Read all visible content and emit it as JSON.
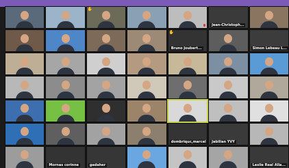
{
  "window": {
    "accent_color": "#7c5ab7",
    "active_speaker_color": "#c9d34a"
  },
  "tiles": [
    {
      "label": "",
      "bg": "#5b6a7a",
      "hand": false,
      "mic": false,
      "big": false
    },
    {
      "label": "",
      "bg": "#9cb4c9",
      "hand": false,
      "mic": false,
      "big": false
    },
    {
      "label": "",
      "bg": "#6c6a58",
      "hand": true,
      "mic": false,
      "big": false
    },
    {
      "label": "",
      "bg": "#8aa0b5",
      "hand": false,
      "mic": false,
      "big": false
    },
    {
      "label": "",
      "bg": "#bdbdbd",
      "hand": false,
      "mic": true,
      "big": false
    },
    {
      "label": "Jean-Christoph...",
      "bg": "#3a3a3a",
      "hand": false,
      "mic": false,
      "big": true
    },
    {
      "label": "",
      "bg": "#8a7660",
      "hand": false,
      "mic": false,
      "big": false
    },
    {
      "label": "",
      "bg": "#6f5a4a",
      "hand": false,
      "mic": false,
      "big": false
    },
    {
      "label": "",
      "bg": "#4e86c7",
      "hand": false,
      "mic": false,
      "big": false
    },
    {
      "label": "",
      "bg": "#7e6a58",
      "hand": false,
      "mic": false,
      "big": false
    },
    {
      "label": "",
      "bg": "#9d8a76",
      "hand": false,
      "mic": false,
      "big": false
    },
    {
      "label": "Bruno Joubert...",
      "bg": "#333333",
      "hand": true,
      "mic": false,
      "big": true
    },
    {
      "label": "",
      "bg": "#5d5d5d",
      "hand": false,
      "mic": false,
      "big": false
    },
    {
      "label": "Simon Lebeau L...",
      "bg": "#3c3c3c",
      "hand": false,
      "mic": false,
      "big": true
    },
    {
      "label": "",
      "bg": "#bfae96",
      "hand": false,
      "mic": false,
      "big": false
    },
    {
      "label": "",
      "bg": "#a6a6a6",
      "hand": false,
      "mic": false,
      "big": false
    },
    {
      "label": "",
      "bg": "#cfcfcf",
      "hand": false,
      "mic": false,
      "big": false
    },
    {
      "label": "",
      "bg": "#b39a80",
      "hand": false,
      "mic": false,
      "big": false
    },
    {
      "label": "",
      "bg": "#c7b89a",
      "hand": false,
      "mic": false,
      "big": false
    },
    {
      "label": "",
      "bg": "#7d8fa3",
      "hand": false,
      "mic": false,
      "big": false
    },
    {
      "label": "",
      "bg": "#5a9bd6",
      "hand": false,
      "mic": false,
      "big": false
    },
    {
      "label": "",
      "bg": "#b8b8b8",
      "hand": false,
      "mic": false,
      "big": false
    },
    {
      "label": "",
      "bg": "#8c8c8c",
      "hand": false,
      "mic": false,
      "big": false
    },
    {
      "label": "",
      "bg": "#a3a3a3",
      "hand": false,
      "mic": false,
      "big": false
    },
    {
      "label": "",
      "bg": "#d0c8b8",
      "hand": false,
      "mic": false,
      "big": false
    },
    {
      "label": "",
      "bg": "#6e6e6e",
      "hand": false,
      "mic": false,
      "big": false
    },
    {
      "label": "",
      "bg": "#c9c9c9",
      "hand": false,
      "mic": false,
      "big": false
    },
    {
      "label": "",
      "bg": "#b0a89a",
      "hand": false,
      "mic": false,
      "big": false
    },
    {
      "label": "",
      "bg": "#3d6fb0",
      "hand": false,
      "mic": false,
      "big": false
    },
    {
      "label": "",
      "bg": "#76c043",
      "hand": false,
      "mic": false,
      "big": false
    },
    {
      "label": "",
      "bg": "#2f2f2f",
      "hand": false,
      "mic": false,
      "big": false
    },
    {
      "label": "",
      "bg": "#9b8468",
      "hand": false,
      "mic": false,
      "big": false
    },
    {
      "label": "",
      "bg": "#d9d9d9",
      "hand": false,
      "mic": false,
      "big": false,
      "active": true
    },
    {
      "label": "",
      "bg": "#bfbfbf",
      "hand": false,
      "mic": false,
      "big": false
    },
    {
      "label": "",
      "bg": "#e0e0e0",
      "hand": false,
      "mic": false,
      "big": false
    },
    {
      "label": "",
      "bg": "#2f6fb5",
      "hand": false,
      "mic": false,
      "big": false
    },
    {
      "label": "",
      "bg": "#5f5f5f",
      "hand": false,
      "mic": false,
      "big": false
    },
    {
      "label": "",
      "bg": "#a2a2a2",
      "hand": false,
      "mic": false,
      "big": false
    },
    {
      "label": "",
      "bg": "#8c7f6e",
      "hand": false,
      "mic": false,
      "big": false
    },
    {
      "label": "dombriquc,marcel",
      "bg": "#343434",
      "hand": false,
      "mic": false,
      "big": true
    },
    {
      "label": "Jabilian YVY",
      "bg": "#3a3a3a",
      "hand": false,
      "mic": false,
      "big": true
    },
    {
      "label": "",
      "bg": "#b7b7b7",
      "hand": false,
      "mic": false,
      "big": false
    },
    {
      "label": "",
      "bg": "#9c9c9c",
      "hand": false,
      "mic": false,
      "big": false
    },
    {
      "label": "Mornas corinne",
      "bg": "#333333",
      "hand": false,
      "mic": false,
      "big": true
    },
    {
      "label": "gadaher",
      "bg": "#363636",
      "hand": false,
      "mic": false,
      "big": true
    },
    {
      "label": "",
      "bg": "#6aa7e0",
      "hand": false,
      "mic": false,
      "big": false
    },
    {
      "label": "",
      "bg": "#c4c4c4",
      "hand": false,
      "mic": false,
      "big": false
    },
    {
      "label": "",
      "bg": "#a5a5a5",
      "hand": false,
      "mic": false,
      "big": false
    },
    {
      "label": "Leslie Real Alla...",
      "bg": "#393939",
      "hand": false,
      "mic": false,
      "big": true
    }
  ]
}
